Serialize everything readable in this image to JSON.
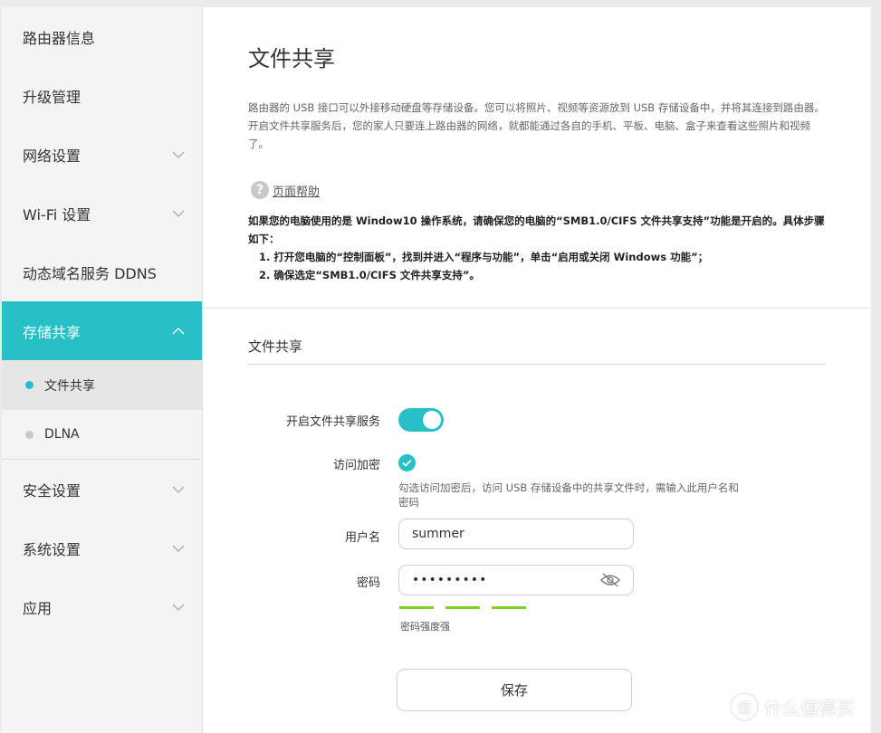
{
  "sidebar": {
    "items": [
      {
        "label": "路由器信息",
        "expandable": false
      },
      {
        "label": "升级管理",
        "expandable": false
      },
      {
        "label": "网络设置",
        "expandable": true
      },
      {
        "label": "Wi-Fi 设置",
        "expandable": true
      },
      {
        "label": "动态域名服务 DDNS",
        "expandable": false
      },
      {
        "label": "存储共享",
        "expandable": true,
        "active": true,
        "children": [
          {
            "label": "文件共享",
            "selected": true
          },
          {
            "label": "DLNA",
            "selected": false
          }
        ]
      },
      {
        "label": "安全设置",
        "expandable": true
      },
      {
        "label": "系统设置",
        "expandable": true
      },
      {
        "label": "应用",
        "expandable": true
      }
    ]
  },
  "main": {
    "title": "文件共享",
    "description": "路由器的 USB 接口可以外接移动硬盘等存储设备。您可以将照片、视频等资源放到 USB 存储设备中，并将其连接到路由器。开启文件共享服务后，您的家人只要连上路由器的网络，就都能通过各自的手机、平板、电脑、盒子来查看这些照片和视频了。",
    "help_icon_glyph": "?",
    "help_label": "页面帮助",
    "notice": {
      "intro": "如果您的电脑使用的是 Window10 操作系统，请确保您的电脑的“SMB1.0/CIFS 文件共享支持”功能是开启的。具体步骤如下：",
      "step1": "1. 打开您电脑的“控制面板”，找到并进入“程序与功能”，单击“启用或关闭 Windows 功能”；",
      "step2": "2. 确保选定“SMB1.0/CIFS 文件共享支持”。"
    },
    "section_title": "文件共享",
    "form": {
      "enable_label": "开启文件共享服务",
      "enable_value": true,
      "encrypt_label": "访问加密",
      "encrypt_value": true,
      "encrypt_hint": "勾选访问加密后，访问 USB 存储设备中的共享文件时，需输入此用户名和密码",
      "username_label": "用户名",
      "username_value": "summer",
      "password_label": "密码",
      "password_value": "•••••••••",
      "strength_label": "密码强度强",
      "strength_level": 3,
      "save_label": "保存"
    }
  },
  "watermark": {
    "icon_glyph": "值",
    "text": "什么值得买"
  },
  "colors": {
    "accent": "#27c0c7",
    "strength": "#7ed321"
  }
}
